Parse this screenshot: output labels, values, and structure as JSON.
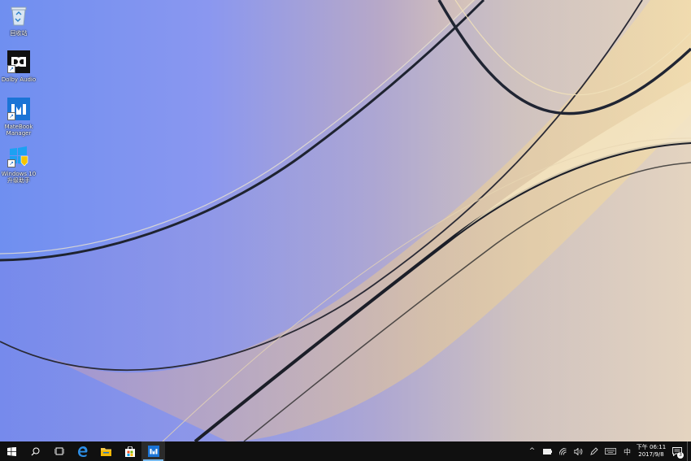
{
  "desktop": {
    "icons": [
      {
        "label": "回收站",
        "icon": "recycle-bin-icon"
      },
      {
        "label": "Dolby Audio",
        "icon": "dolby-audio-icon"
      },
      {
        "label": "MateBook Manager",
        "icon": "matebook-manager-icon"
      },
      {
        "label": "Windows 10 升级助手",
        "icon": "windows-upgrade-icon"
      }
    ]
  },
  "taskbar": {
    "buttons": [
      {
        "icon": "start-icon"
      },
      {
        "icon": "search-icon"
      },
      {
        "icon": "task-view-icon"
      },
      {
        "icon": "edge-icon"
      },
      {
        "icon": "file-explorer-icon"
      },
      {
        "icon": "store-icon"
      },
      {
        "icon": "matebook-manager-icon",
        "active": true
      }
    ],
    "tray": {
      "chevron": "^",
      "ime": "中",
      "clock": {
        "time": "下午 06:11",
        "date": "2017/9/8"
      },
      "notifications": "3"
    }
  },
  "colors": {
    "taskbar": "#101010",
    "accent": "#0078d7",
    "active_underline": "#76b9ed"
  }
}
